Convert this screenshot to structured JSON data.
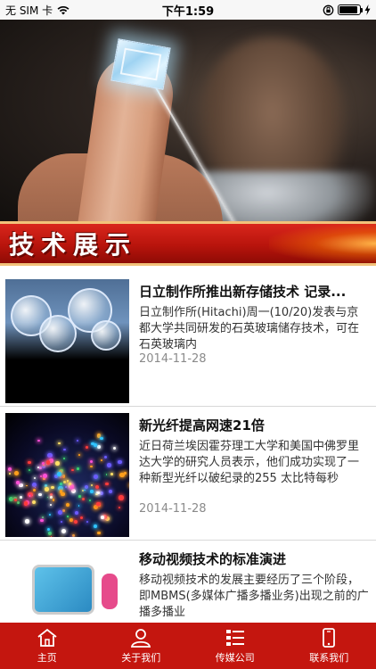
{
  "status_bar": {
    "carrier": "无 SIM 卡",
    "time": "下午1:59",
    "battery_level": 0.92
  },
  "section": {
    "title": "技术展示"
  },
  "news": [
    {
      "title": "日立制作所推出新存储技术 记录...",
      "summary": "日立制作所(Hitachi)周一(10/20)发表与京都大学共同研发的石英玻璃储存技术，可在石英玻璃内",
      "date": "2014-11-28",
      "thumb_icon": "quartz-glass-discs-image"
    },
    {
      "title": "新光纤提高网速21倍",
      "summary": "近日荷兰埃因霍芬理工大学和美国中佛罗里达大学的研究人员表示，他们成功实现了一种新型光纤以破纪录的255 太比特每秒",
      "date": "2014-11-28",
      "thumb_icon": "optical-fiber-image"
    },
    {
      "title": "移动视频技术的标准演进",
      "summary": "移动视频技术的发展主要经历了三个阶段，即MBMS(多媒体广播多播业务)出现之前的广播多播业",
      "date": "",
      "thumb_icon": "mobile-video-image"
    }
  ],
  "tab_bar": {
    "background": "#c4160f",
    "items": [
      {
        "label": "主页",
        "icon": "home-icon"
      },
      {
        "label": "关于我们",
        "icon": "person-icon"
      },
      {
        "label": "传媒公司",
        "icon": "list-icon"
      },
      {
        "label": "联系我们",
        "icon": "phone-icon"
      }
    ]
  }
}
